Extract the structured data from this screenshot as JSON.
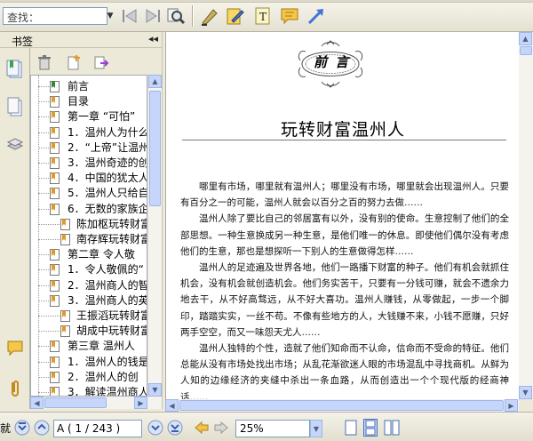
{
  "toolbar": {
    "search_placeholder": "查找："
  },
  "bookmark_panel": {
    "title": "书签",
    "collapse_glyph": "◂◂",
    "items": [
      {
        "label": "前言",
        "indent": false,
        "color": "#2e8b2e"
      },
      {
        "label": "目录",
        "indent": false,
        "color": "#e09a2a"
      },
      {
        "label": "第一章  “可怕”",
        "indent": false,
        "color": "#e09a2a"
      },
      {
        "label": "1．温州人为什么",
        "indent": false,
        "color": "#e09a2a"
      },
      {
        "label": "2．“上帝”让温州",
        "indent": false,
        "color": "#e09a2a"
      },
      {
        "label": "3．温州奇迹的创",
        "indent": false,
        "color": "#e09a2a"
      },
      {
        "label": "4．中国的犹太人",
        "indent": false,
        "color": "#e09a2a"
      },
      {
        "label": "5．温州人只给自",
        "indent": false,
        "color": "#e09a2a"
      },
      {
        "label": "6．无数的家族企",
        "indent": false,
        "color": "#e09a2a"
      },
      {
        "label": "陈加枢玩转财富",
        "indent": true,
        "color": "#e09a2a"
      },
      {
        "label": "南存辉玩转财富",
        "indent": true,
        "color": "#e09a2a"
      },
      {
        "label": "第二章  令人敬",
        "indent": false,
        "color": "#e09a2a"
      },
      {
        "label": "1．令人敬佩的“",
        "indent": false,
        "color": "#e09a2a"
      },
      {
        "label": "2．温州商人的智",
        "indent": false,
        "color": "#e09a2a"
      },
      {
        "label": "3．温州商人的英",
        "indent": false,
        "color": "#e09a2a"
      },
      {
        "label": "王振滔玩转财富",
        "indent": true,
        "color": "#e09a2a"
      },
      {
        "label": "胡成中玩转财富",
        "indent": true,
        "color": "#e09a2a"
      },
      {
        "label": "第三章  温州人",
        "indent": false,
        "color": "#e09a2a"
      },
      {
        "label": "1．温州人的钱是",
        "indent": false,
        "color": "#e09a2a"
      },
      {
        "label": "2．温州人的创",
        "indent": false,
        "color": "#e09a2a"
      },
      {
        "label": "3．解读温州商人",
        "indent": false,
        "color": "#e09a2a"
      }
    ]
  },
  "document": {
    "seal_text": "前 言",
    "title": "玩转财富温州人",
    "paragraphs": [
      "哪里有市场，哪里就有温州人；哪里没有市场，哪里就会出现温州人。只要有百分之一的可能，温州人就会以百分之百的努力去做……",
      "温州人除了要比自己的邻居富有以外，没有别的使命。生意控制了他们的全部思想。一种生意换成另一种生意，是他们唯一的休息。即使他们偶尔没有考虑他们的生意，那也是想探听一下别人的生意做得怎样……",
      "温州人的足迹遍及世界各地，他们一路播下财富的种子。他们有机会就抓住机会，没有机会就创造机会。他们务实苦干，只要有一分钱可赚，就会不遗余力地去干，从不好高骛远，从不好大喜功。温州人赚钱，从零做起，一步一个脚印，踏踏实实，一丝不苟。不像有些地方的人，大钱赚不来，小钱不愿赚，只好两手空空，而又一味怨天尤人……",
      "温州人独特的个性，造就了他们知命而不认命，信命而不受命的特征。他们总能从没有市场处找出市场；从乱花渐欲迷人眼的市场混乱中寻找商机。从鲜为人知的边缘经济的夹缝中杀出一条血路，从而创造出一个个现代版的经商神话……"
    ]
  },
  "statusbar": {
    "left_label": "就",
    "page_indicator": "A ( 1 / 243 )",
    "zoom": "25%"
  }
}
